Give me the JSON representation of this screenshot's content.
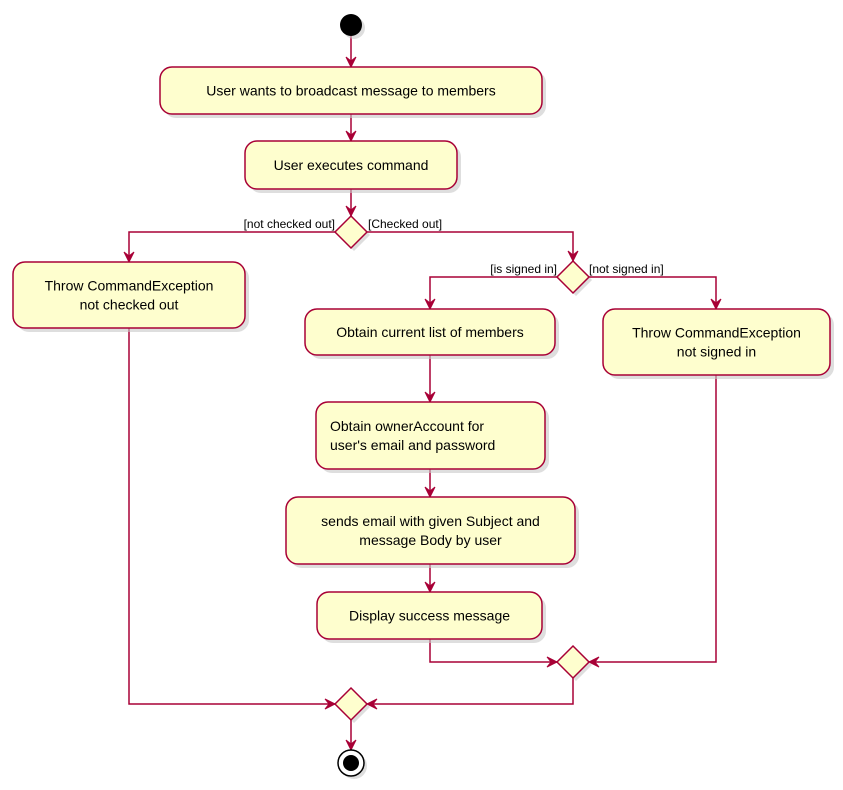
{
  "diagram": {
    "type": "uml-activity",
    "colors": {
      "activity_fill": "#FEFECE",
      "border": "#A80036",
      "start_end": "#000000"
    },
    "start": {
      "name": "start-node"
    },
    "end": {
      "name": "end-node"
    },
    "activities": [
      {
        "id": "a1",
        "lines": [
          "User wants to broadcast message to members"
        ]
      },
      {
        "id": "a2",
        "lines": [
          "User executes command"
        ]
      },
      {
        "id": "a3",
        "lines": [
          "Throw CommandException",
          "not checked out"
        ]
      },
      {
        "id": "a4",
        "lines": [
          "Obtain current list of members"
        ]
      },
      {
        "id": "a5",
        "lines": [
          "Throw CommandException",
          "not signed in"
        ]
      },
      {
        "id": "a6",
        "lines": [
          "Obtain ownerAccount for",
          "user's email and password"
        ]
      },
      {
        "id": "a7",
        "lines": [
          "sends email with given Subject and",
          "message Body by user"
        ]
      },
      {
        "id": "a8",
        "lines": [
          "Display success message"
        ]
      }
    ],
    "decisions": [
      {
        "id": "d1",
        "left_guard": "[not checked out]",
        "right_guard": "[Checked out]"
      },
      {
        "id": "d2",
        "left_guard": "[is signed in]",
        "right_guard": "[not signed in]"
      }
    ],
    "merges": [
      {
        "id": "m1"
      },
      {
        "id": "m2"
      }
    ],
    "edges": [
      [
        "start",
        "a1"
      ],
      [
        "a1",
        "a2"
      ],
      [
        "a2",
        "d1"
      ],
      [
        "d1",
        "a3"
      ],
      [
        "d1",
        "d2"
      ],
      [
        "d2",
        "a4"
      ],
      [
        "d2",
        "a5"
      ],
      [
        "a4",
        "a6"
      ],
      [
        "a6",
        "a7"
      ],
      [
        "a7",
        "a8"
      ],
      [
        "a8",
        "m1"
      ],
      [
        "a5",
        "m1"
      ],
      [
        "a3",
        "m2"
      ],
      [
        "m1",
        "m2"
      ],
      [
        "m2",
        "end"
      ]
    ]
  }
}
